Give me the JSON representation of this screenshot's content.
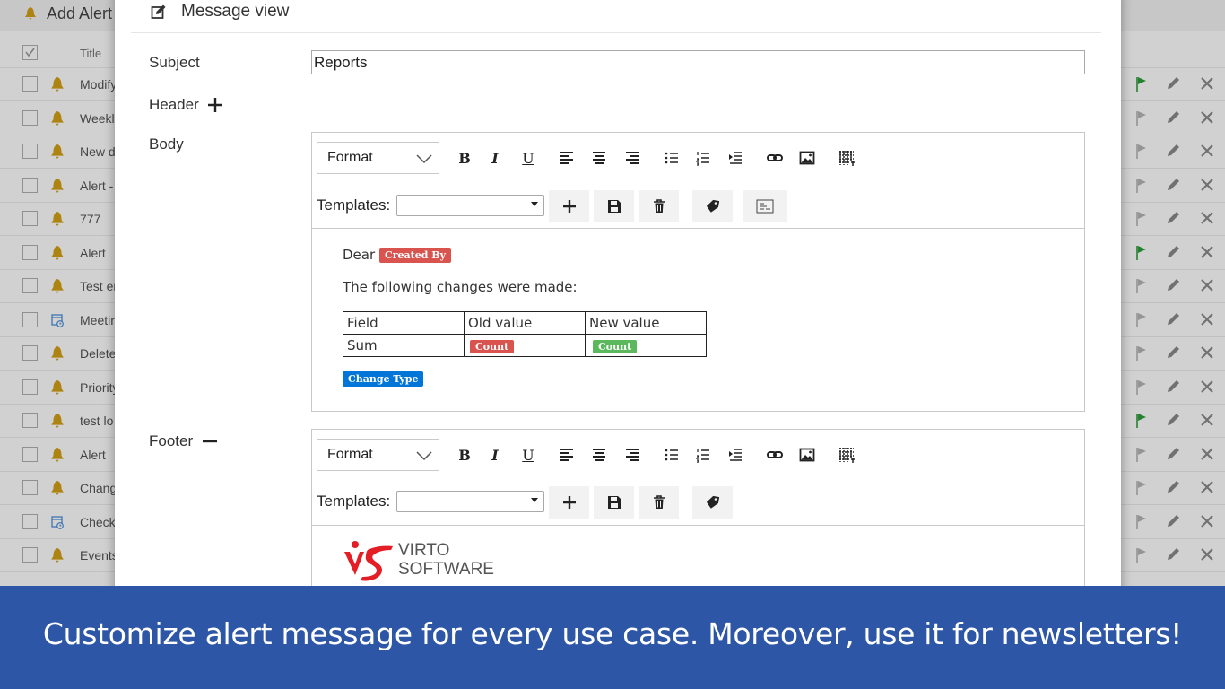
{
  "background": {
    "title": "Add Alert",
    "header_column": "Title",
    "rows": [
      {
        "title": "Modify",
        "icon": "bell-icon",
        "flag": "green"
      },
      {
        "title": "Weekly",
        "icon": "bell-icon",
        "flag": "gray"
      },
      {
        "title": "New d",
        "icon": "bell-icon",
        "flag": "gray"
      },
      {
        "title": "Alert -",
        "icon": "bell-icon",
        "flag": "gray"
      },
      {
        "title": "777",
        "icon": "bell-icon",
        "flag": "gray"
      },
      {
        "title": "Alert",
        "icon": "bell-icon",
        "flag": "green"
      },
      {
        "title": "Test er",
        "icon": "bell-icon",
        "flag": "gray"
      },
      {
        "title": "Meetir",
        "icon": "calendar-icon",
        "flag": "gray"
      },
      {
        "title": "Delete",
        "icon": "bell-icon",
        "flag": "gray"
      },
      {
        "title": "Priority",
        "icon": "bell-icon",
        "flag": "gray"
      },
      {
        "title": "test lo",
        "icon": "bell-icon",
        "flag": "green"
      },
      {
        "title": "Alert",
        "icon": "bell-icon",
        "flag": "gray"
      },
      {
        "title": "Chang",
        "icon": "bell-icon",
        "flag": "gray"
      },
      {
        "title": "Check",
        "icon": "calendar-icon",
        "flag": "gray"
      },
      {
        "title": "Events",
        "icon": "bell-icon",
        "flag": "gray"
      }
    ]
  },
  "modal": {
    "title": "Message view",
    "subject_label": "Subject",
    "subject_value": "Reports",
    "header_label": "Header",
    "body_label": "Body",
    "footer_label": "Footer"
  },
  "toolbar": {
    "format_label": "Format",
    "bold": "B",
    "italic": "I",
    "underline": "U",
    "templates_label": "Templates:"
  },
  "body_content": {
    "greeting": "Dear",
    "created_by_tag": "Created By",
    "changes_text": "The following changes were made:",
    "table_headers": [
      "Field",
      "Old value",
      "New value"
    ],
    "table_row": {
      "field": "Sum",
      "old_tag": "Count",
      "new_tag": "Count"
    },
    "change_type_tag": "Change Type"
  },
  "footer_content": {
    "logo_line1": "VIRTO",
    "logo_line2": "SOFTWARE"
  },
  "banner": {
    "text": "Customize alert message for every use case. Moreover, use it for newsletters!"
  },
  "colors": {
    "banner": "#2e56a6",
    "tag_red": "#d9534f",
    "tag_green": "#5cb85c",
    "tag_blue": "#0275d8",
    "flag_green": "#2e9e3a",
    "bell": "#d4a017"
  }
}
